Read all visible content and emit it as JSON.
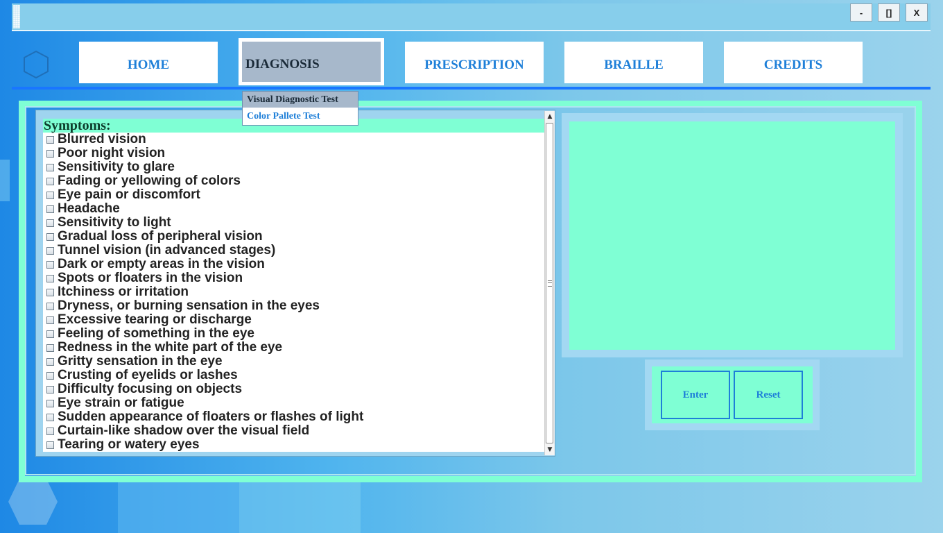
{
  "window": {
    "minimize_label": "-",
    "maximize_label": "[]",
    "close_label": "X"
  },
  "nav": {
    "items": [
      {
        "label": "HOME"
      },
      {
        "label": "DIAGNOSIS"
      },
      {
        "label": "PRESCRIPTION"
      },
      {
        "label": "BRAILLE"
      },
      {
        "label": "CREDITS"
      }
    ],
    "active": "DIAGNOSIS"
  },
  "diagnosis_menu": {
    "items": [
      {
        "label": "Visual Diagnostic Test"
      },
      {
        "label": "Color Pallete Test"
      }
    ]
  },
  "symptoms": {
    "header": "Symptoms:",
    "items": [
      "Blurred vision",
      "Poor night vision",
      "Sensitivity to glare",
      "Fading or yellowing of colors",
      "Eye pain or discomfort",
      "Headache",
      "Sensitivity to light",
      "Gradual loss of peripheral vision",
      "Tunnel vision (in advanced stages)",
      "Dark or empty areas in the vision",
      "Spots or floaters in the vision",
      "Itchiness or irritation",
      "Dryness, or burning sensation in the eyes",
      "Excessive tearing or discharge",
      "Feeling of something in the eye",
      "Redness in the white part of the eye",
      "Gritty sensation in the eye",
      "Crusting of eyelids or lashes",
      "Difficulty focusing on objects",
      "Eye strain or fatigue",
      "Sudden appearance of floaters or flashes of light",
      "Curtain-like shadow over the visual field",
      "Tearing or watery eyes"
    ]
  },
  "actions": {
    "enter_label": "Enter",
    "reset_label": "Reset"
  },
  "colors": {
    "accent": "#1e7fd8",
    "panel": "#7fffd4",
    "nav_active": "#a7b8cb",
    "titlebar": "#87ceeb"
  },
  "icons": {
    "nav_logo": "hexagon-icon",
    "scroll_up": "arrow-up-icon",
    "scroll_down": "arrow-down-icon"
  }
}
